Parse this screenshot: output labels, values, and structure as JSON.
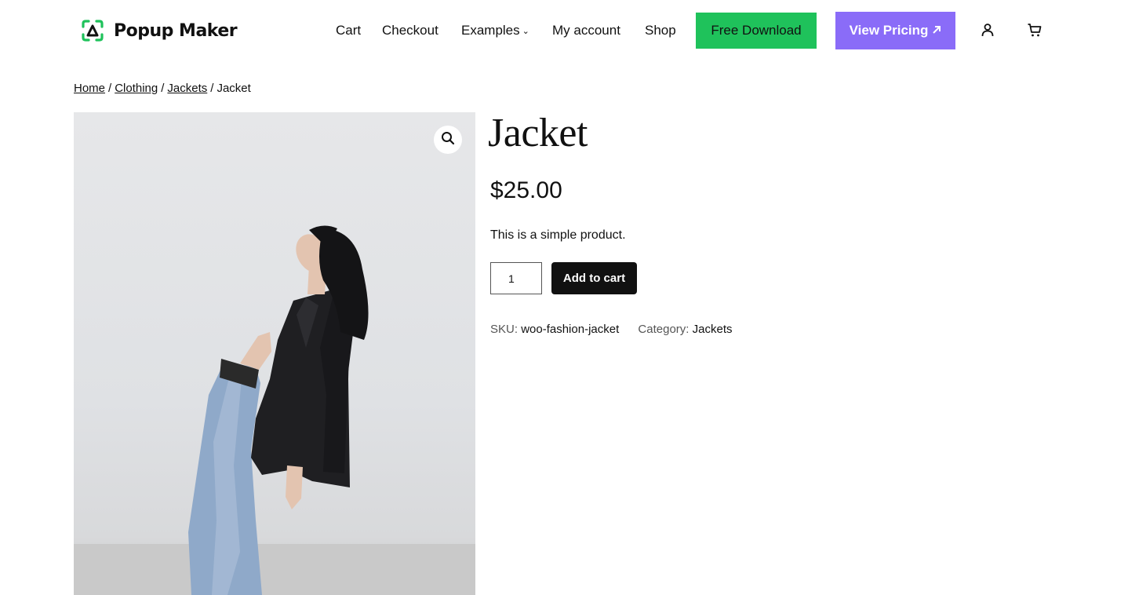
{
  "header": {
    "logo_text": "Popup Maker",
    "logo_icon": "popup-maker-logo-icon",
    "nav": [
      {
        "label": "Cart"
      },
      {
        "label": "Checkout"
      },
      {
        "label": "Examples",
        "has_dropdown": true
      },
      {
        "label": "My account"
      },
      {
        "label": "Shop"
      }
    ],
    "free_download_label": "Free Download",
    "view_pricing_label": "View Pricing",
    "view_pricing_icon": "arrow-up-right-icon",
    "account_icon": "user-icon",
    "cart_icon": "cart-icon"
  },
  "breadcrumb": {
    "items": [
      "Home",
      "Clothing",
      "Jackets"
    ],
    "separator": "/",
    "current": "Jacket"
  },
  "product": {
    "image_alt": "Woman in black blazer and jeans leaning backwards",
    "zoom_icon": "magnify-icon",
    "title": "Jacket",
    "price": "$25.00",
    "description": "This is a simple product.",
    "quantity": "1",
    "add_to_cart_label": "Add to cart",
    "sku_label": "SKU:",
    "sku_value": "woo-fashion-jacket",
    "category_label": "Category:",
    "category_value": "Jackets"
  },
  "colors": {
    "free_download_bg": "#1fc25b",
    "view_pricing_bg": "#8a6cf8",
    "logo_green": "#1fc25b",
    "add_to_cart_bg": "#111111"
  }
}
